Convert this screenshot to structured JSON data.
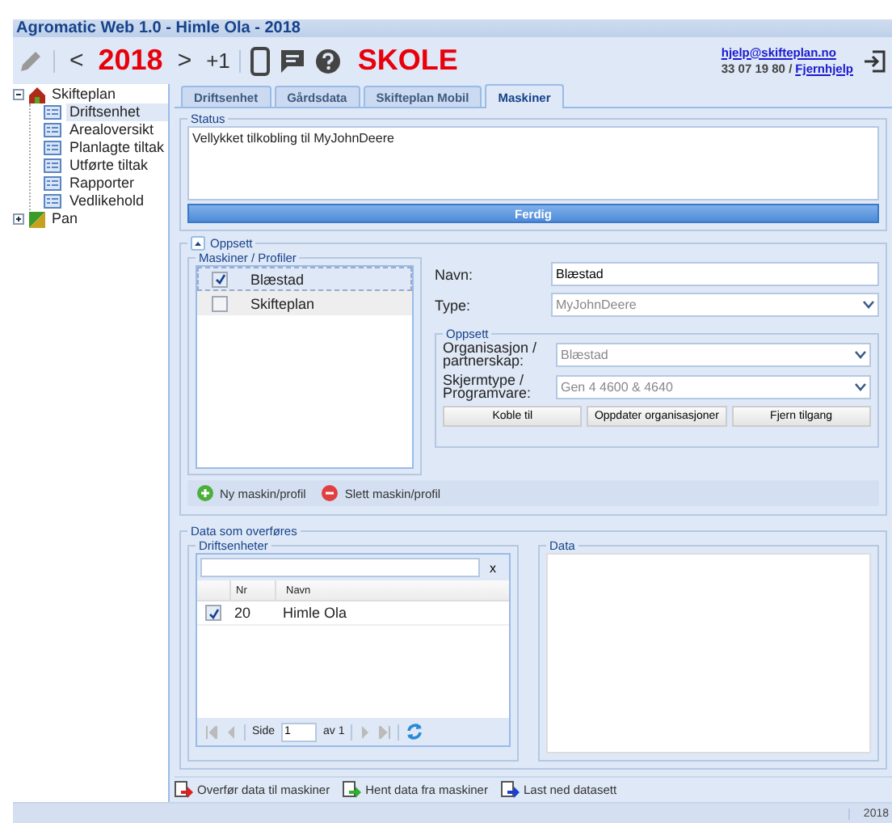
{
  "window": {
    "title": "Agromatic Web 1.0 - Himle Ola - 2018"
  },
  "toolbar": {
    "prev": "<",
    "year": "2018",
    "next": ">",
    "increment": "+1",
    "school": "SKOLE",
    "email": "hjelp@skifteplan.no",
    "phone": "33 07 19 80 /",
    "remote_help": "Fjernhjelp"
  },
  "sidebar": {
    "items": [
      {
        "label": "Skifteplan",
        "expanded": true,
        "children": [
          {
            "label": "Driftsenhet",
            "selected": true
          },
          {
            "label": "Arealoversikt",
            "selected": false
          },
          {
            "label": "Planlagte tiltak",
            "selected": false
          },
          {
            "label": "Utførte tiltak",
            "selected": false
          },
          {
            "label": "Rapporter",
            "selected": false
          },
          {
            "label": "Vedlikehold",
            "selected": false
          }
        ]
      },
      {
        "label": "Pan",
        "expanded": false
      }
    ]
  },
  "tabs": [
    {
      "label": "Driftsenhet",
      "selected": false
    },
    {
      "label": "Gårdsdata",
      "selected": false
    },
    {
      "label": "Skifteplan Mobil",
      "selected": false
    },
    {
      "label": "Maskiner",
      "selected": true
    }
  ],
  "status": {
    "legend": "Status",
    "message": "Vellykket tilkobling til MyJohnDeere",
    "button": "Ferdig"
  },
  "setup": {
    "legend": "Oppsett",
    "expanded": true,
    "profiles": {
      "legend": "Maskiner / Profiler",
      "items": [
        {
          "label": "Blæstad",
          "checked": true,
          "selected": true
        },
        {
          "label": "Skifteplan",
          "checked": false,
          "selected": false
        }
      ]
    },
    "name_label": "Navn:",
    "name_value": "Blæstad",
    "type_label": "Type:",
    "type_value": "MyJohnDeere",
    "group": {
      "legend": "Oppsett",
      "org_label": "Organisasjon / partnerskap:",
      "org_value": "Blæstad",
      "screen_label": "Skjermtype / Programvare:",
      "screen_value": "Gen 4 4600 & 4640",
      "buttons": [
        "Koble til",
        "Oppdater organisasjoner",
        "Fjern tilgang"
      ]
    },
    "actions": [
      {
        "label": "Ny maskin/profil",
        "kind": "add"
      },
      {
        "label": "Slett maskin/profil",
        "kind": "remove"
      }
    ]
  },
  "transfer": {
    "legend": "Data som overføres",
    "units": {
      "legend": "Driftsenheter",
      "clear": "x",
      "columns": [
        "Nr",
        "Navn"
      ],
      "rows": [
        {
          "checked": true,
          "nr": "20",
          "name": "Himle Ola"
        }
      ],
      "pager": {
        "page_label": "Side",
        "page": "1",
        "of": "av 1"
      }
    },
    "data": {
      "legend": "Data"
    }
  },
  "bottom_actions": [
    {
      "label": "Overfør data til maskiner",
      "kind": "upload"
    },
    {
      "label": "Hent data fra maskiner",
      "kind": "fetch"
    },
    {
      "label": "Last ned datasett",
      "kind": "download"
    }
  ],
  "status_bar": {
    "text": "2018"
  }
}
